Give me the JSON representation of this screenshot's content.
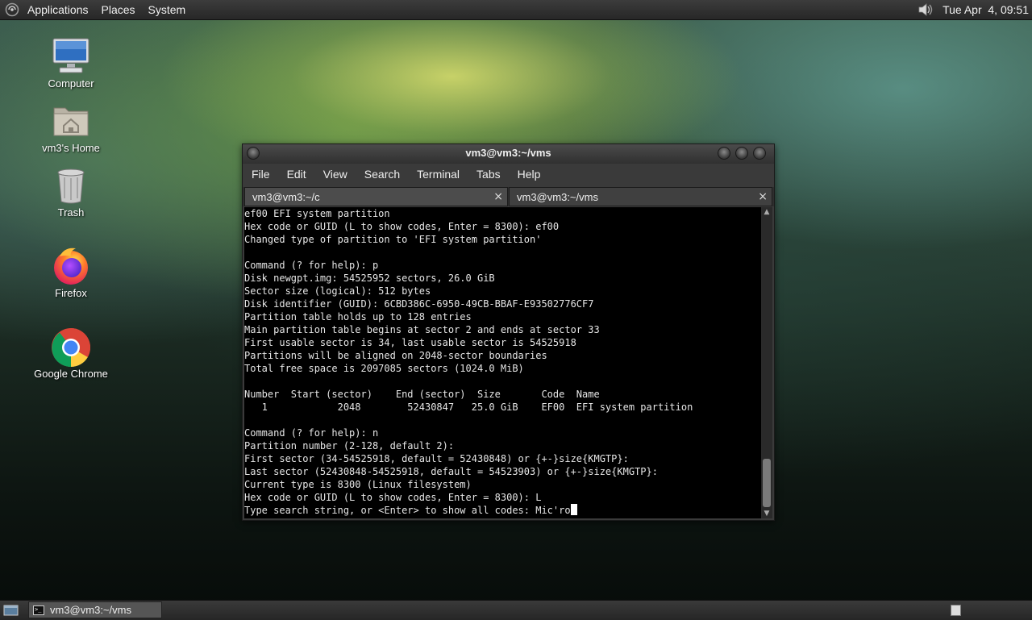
{
  "top_panel": {
    "menus": [
      "Applications",
      "Places",
      "System"
    ],
    "clock": "Tue Apr  4, 09:51",
    "icons": [
      "distro-logo-icon",
      "volume-icon"
    ]
  },
  "desktop_icons": [
    {
      "label": "Computer",
      "icon": "computer-icon"
    },
    {
      "label": "vm3's Home",
      "icon": "home-folder-icon"
    },
    {
      "label": "Trash",
      "icon": "trash-icon"
    },
    {
      "label": "Firefox",
      "icon": "firefox-icon"
    },
    {
      "label": "Google Chrome",
      "icon": "chrome-icon"
    }
  ],
  "terminal": {
    "title": "vm3@vm3:~/vms",
    "menu": [
      "File",
      "Edit",
      "View",
      "Search",
      "Terminal",
      "Tabs",
      "Help"
    ],
    "tabs": [
      {
        "label": "vm3@vm3:~/c",
        "close": "×"
      },
      {
        "label": "vm3@vm3:~/vms",
        "close": "×"
      }
    ],
    "lines": [
      "ef00 EFI system partition",
      "Hex code or GUID (L to show codes, Enter = 8300): ef00",
      "Changed type of partition to 'EFI system partition'",
      "",
      "Command (? for help): p",
      "Disk newgpt.img: 54525952 sectors, 26.0 GiB",
      "Sector size (logical): 512 bytes",
      "Disk identifier (GUID): 6CBD386C-6950-49CB-BBAF-E93502776CF7",
      "Partition table holds up to 128 entries",
      "Main partition table begins at sector 2 and ends at sector 33",
      "First usable sector is 34, last usable sector is 54525918",
      "Partitions will be aligned on 2048-sector boundaries",
      "Total free space is 2097085 sectors (1024.0 MiB)",
      "",
      "Number  Start (sector)    End (sector)  Size       Code  Name",
      "   1            2048        52430847   25.0 GiB    EF00  EFI system partition",
      "",
      "Command (? for help): n",
      "Partition number (2-128, default 2):",
      "First sector (34-54525918, default = 52430848) or {+-}size{KMGTP}:",
      "Last sector (52430848-54525918, default = 54523903) or {+-}size{KMGTP}:",
      "Current type is 8300 (Linux filesystem)",
      "Hex code or GUID (L to show codes, Enter = 8300): L",
      "Type search string, or <Enter> to show all codes: Mic'ro"
    ]
  },
  "taskbar": {
    "task_label": "vm3@vm3:~/vms",
    "task_icon_text": ">_"
  }
}
